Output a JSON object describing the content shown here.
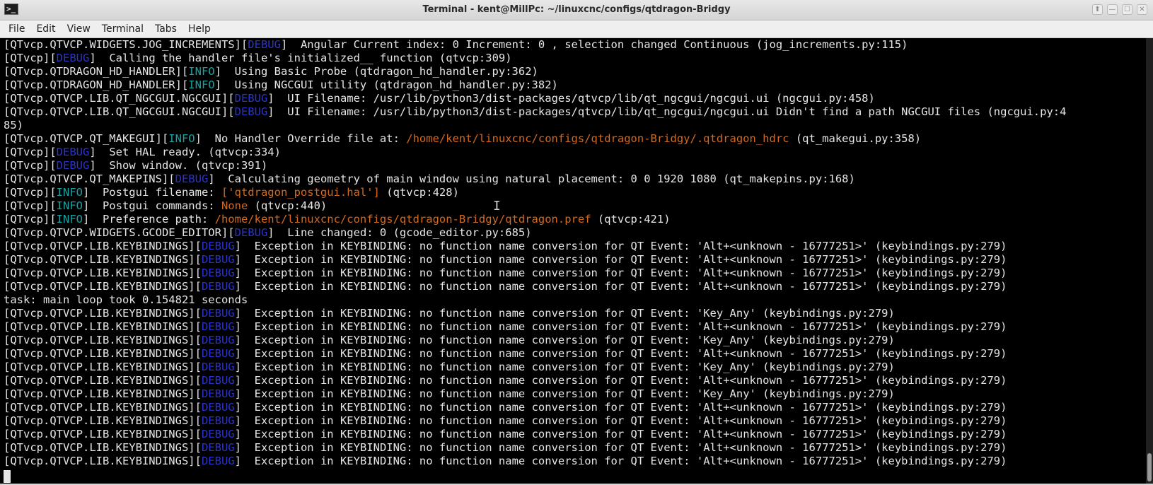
{
  "window": {
    "title": "Terminal - kent@MillPc: ~/linuxcnc/configs/qtdragon-Bridgy",
    "icon": "terminal-app-icon",
    "buttons": {
      "up": "⬆",
      "minimize": "—",
      "maximize": "☐",
      "close": "✕"
    }
  },
  "menu": [
    "File",
    "Edit",
    "View",
    "Terminal",
    "Tabs",
    "Help"
  ],
  "colors": {
    "debug": "#2b34c9",
    "info": "#19a2a2",
    "path": "#d2691e",
    "text": "#e5e5e5",
    "background": "#000000"
  },
  "terminal_lines": [
    [
      [
        "[QTvcp.QTVCP.WIDGETS.JOG_INCREMENTS][",
        ""
      ],
      [
        "DEBUG",
        "dbg"
      ],
      [
        "]  Angular Current index: 0 Increment: 0 , selection changed Continuous (jog_increments.py:115)",
        ""
      ]
    ],
    [
      [
        "[QTvcp][",
        ""
      ],
      [
        "DEBUG",
        "dbg"
      ],
      [
        "]  Calling the handler file's initialized__ function (qtvcp:309)",
        ""
      ]
    ],
    [
      [
        "[QTvcp.QTDRAGON_HD_HANDLER][",
        ""
      ],
      [
        "INFO",
        "inf"
      ],
      [
        "]  Using Basic Probe (qtdragon_hd_handler.py:362)",
        ""
      ]
    ],
    [
      [
        "[QTvcp.QTDRAGON_HD_HANDLER][",
        ""
      ],
      [
        "INFO",
        "inf"
      ],
      [
        "]  Using NGCGUI utility (qtdragon_hd_handler.py:382)",
        ""
      ]
    ],
    [
      [
        "[QTvcp.QTVCP.LIB.QT_NGCGUI.NGCGUI][",
        ""
      ],
      [
        "DEBUG",
        "dbg"
      ],
      [
        "]  UI Filename: /usr/lib/python3/dist-packages/qtvcp/lib/qt_ngcgui/ngcgui.ui (ngcgui.py:458)",
        ""
      ]
    ],
    [
      [
        "[QTvcp.QTVCP.LIB.QT_NGCGUI.NGCGUI][",
        ""
      ],
      [
        "DEBUG",
        "dbg"
      ],
      [
        "]  UI Filename: /usr/lib/python3/dist-packages/qtvcp/lib/qt_ngcgui/ngcgui.ui Didn't find a path NGCGUI files (ngcgui.py:4",
        ""
      ]
    ],
    [
      [
        "85)",
        ""
      ]
    ],
    [
      [
        "[QTvcp.QTVCP.QT_MAKEGUI][",
        ""
      ],
      [
        "INFO",
        "inf"
      ],
      [
        "]  No Handler Override file at: ",
        ""
      ],
      [
        "/home/kent/linuxcnc/configs/qtdragon-Bridgy/.qtdragon_hdrc",
        "org"
      ],
      [
        " (qt_makegui.py:358)",
        ""
      ]
    ],
    [
      [
        "[QTvcp][",
        ""
      ],
      [
        "DEBUG",
        "dbg"
      ],
      [
        "]  Set HAL ready. (qtvcp:334)",
        ""
      ]
    ],
    [
      [
        "[QTvcp][",
        ""
      ],
      [
        "DEBUG",
        "dbg"
      ],
      [
        "]  Show window. (qtvcp:391)",
        ""
      ]
    ],
    [
      [
        "[QTvcp.QTVCP.QT_MAKEPINS][",
        ""
      ],
      [
        "DEBUG",
        "dbg"
      ],
      [
        "]  Calculating geometry of main window using natural placement: 0 0 1920 1080 (qt_makepins.py:168)",
        ""
      ]
    ],
    [
      [
        "[QTvcp][",
        ""
      ],
      [
        "INFO",
        "inf"
      ],
      [
        "]  Postgui filename: ",
        ""
      ],
      [
        "['qtdragon_postgui.hal']",
        "org"
      ],
      [
        " (qtvcp:428)",
        ""
      ]
    ],
    [
      [
        "[QTvcp][",
        ""
      ],
      [
        "INFO",
        "inf"
      ],
      [
        "]  Postgui commands: ",
        ""
      ],
      [
        "None",
        "org"
      ],
      [
        " (qtvcp:440)",
        ""
      ]
    ],
    [
      [
        "[QTvcp][",
        ""
      ],
      [
        "INFO",
        "inf"
      ],
      [
        "]  Preference path: ",
        ""
      ],
      [
        "/home/kent/linuxcnc/configs/qtdragon-Bridgy/qtdragon.pref",
        "org"
      ],
      [
        " (qtvcp:421)",
        ""
      ]
    ],
    [
      [
        "[QTvcp.QTVCP.WIDGETS.GCODE_EDITOR][",
        ""
      ],
      [
        "DEBUG",
        "dbg"
      ],
      [
        "]  Line changed: 0 (gcode_editor.py:685)",
        ""
      ]
    ],
    [
      [
        "[QTvcp.QTVCP.LIB.KEYBINDINGS][",
        ""
      ],
      [
        "DEBUG",
        "dbg"
      ],
      [
        "]  Exception in KEYBINDING: no function name conversion for QT Event: 'Alt+<unknown - 16777251>' (keybindings.py:279)",
        ""
      ]
    ],
    [
      [
        "[QTvcp.QTVCP.LIB.KEYBINDINGS][",
        ""
      ],
      [
        "DEBUG",
        "dbg"
      ],
      [
        "]  Exception in KEYBINDING: no function name conversion for QT Event: 'Alt+<unknown - 16777251>' (keybindings.py:279)",
        ""
      ]
    ],
    [
      [
        "[QTvcp.QTVCP.LIB.KEYBINDINGS][",
        ""
      ],
      [
        "DEBUG",
        "dbg"
      ],
      [
        "]  Exception in KEYBINDING: no function name conversion for QT Event: 'Alt+<unknown - 16777251>' (keybindings.py:279)",
        ""
      ]
    ],
    [
      [
        "[QTvcp.QTVCP.LIB.KEYBINDINGS][",
        ""
      ],
      [
        "DEBUG",
        "dbg"
      ],
      [
        "]  Exception in KEYBINDING: no function name conversion for QT Event: 'Alt+<unknown - 16777251>' (keybindings.py:279)",
        ""
      ]
    ],
    [
      [
        "task: main loop took 0.154821 seconds",
        ""
      ]
    ],
    [
      [
        "[QTvcp.QTVCP.LIB.KEYBINDINGS][",
        ""
      ],
      [
        "DEBUG",
        "dbg"
      ],
      [
        "]  Exception in KEYBINDING: no function name conversion for QT Event: 'Key_Any' (keybindings.py:279)",
        ""
      ]
    ],
    [
      [
        "[QTvcp.QTVCP.LIB.KEYBINDINGS][",
        ""
      ],
      [
        "DEBUG",
        "dbg"
      ],
      [
        "]  Exception in KEYBINDING: no function name conversion for QT Event: 'Alt+<unknown - 16777251>' (keybindings.py:279)",
        ""
      ]
    ],
    [
      [
        "[QTvcp.QTVCP.LIB.KEYBINDINGS][",
        ""
      ],
      [
        "DEBUG",
        "dbg"
      ],
      [
        "]  Exception in KEYBINDING: no function name conversion for QT Event: 'Key_Any' (keybindings.py:279)",
        ""
      ]
    ],
    [
      [
        "[QTvcp.QTVCP.LIB.KEYBINDINGS][",
        ""
      ],
      [
        "DEBUG",
        "dbg"
      ],
      [
        "]  Exception in KEYBINDING: no function name conversion for QT Event: 'Alt+<unknown - 16777251>' (keybindings.py:279)",
        ""
      ]
    ],
    [
      [
        "[QTvcp.QTVCP.LIB.KEYBINDINGS][",
        ""
      ],
      [
        "DEBUG",
        "dbg"
      ],
      [
        "]  Exception in KEYBINDING: no function name conversion for QT Event: 'Key_Any' (keybindings.py:279)",
        ""
      ]
    ],
    [
      [
        "[QTvcp.QTVCP.LIB.KEYBINDINGS][",
        ""
      ],
      [
        "DEBUG",
        "dbg"
      ],
      [
        "]  Exception in KEYBINDING: no function name conversion for QT Event: 'Alt+<unknown - 16777251>' (keybindings.py:279)",
        ""
      ]
    ],
    [
      [
        "[QTvcp.QTVCP.LIB.KEYBINDINGS][",
        ""
      ],
      [
        "DEBUG",
        "dbg"
      ],
      [
        "]  Exception in KEYBINDING: no function name conversion for QT Event: 'Key_Any' (keybindings.py:279)",
        ""
      ]
    ],
    [
      [
        "[QTvcp.QTVCP.LIB.KEYBINDINGS][",
        ""
      ],
      [
        "DEBUG",
        "dbg"
      ],
      [
        "]  Exception in KEYBINDING: no function name conversion for QT Event: 'Alt+<unknown - 16777251>' (keybindings.py:279)",
        ""
      ]
    ],
    [
      [
        "[QTvcp.QTVCP.LIB.KEYBINDINGS][",
        ""
      ],
      [
        "DEBUG",
        "dbg"
      ],
      [
        "]  Exception in KEYBINDING: no function name conversion for QT Event: 'Alt+<unknown - 16777251>' (keybindings.py:279)",
        ""
      ]
    ],
    [
      [
        "[QTvcp.QTVCP.LIB.KEYBINDINGS][",
        ""
      ],
      [
        "DEBUG",
        "dbg"
      ],
      [
        "]  Exception in KEYBINDING: no function name conversion for QT Event: 'Alt+<unknown - 16777251>' (keybindings.py:279)",
        ""
      ]
    ],
    [
      [
        "[QTvcp.QTVCP.LIB.KEYBINDINGS][",
        ""
      ],
      [
        "DEBUG",
        "dbg"
      ],
      [
        "]  Exception in KEYBINDING: no function name conversion for QT Event: 'Alt+<unknown - 16777251>' (keybindings.py:279)",
        ""
      ]
    ],
    [
      [
        "[QTvcp.QTVCP.LIB.KEYBINDINGS][",
        ""
      ],
      [
        "DEBUG",
        "dbg"
      ],
      [
        "]  Exception in KEYBINDING: no function name conversion for QT Event: 'Alt+<unknown - 16777251>' (keybindings.py:279)",
        ""
      ]
    ]
  ]
}
